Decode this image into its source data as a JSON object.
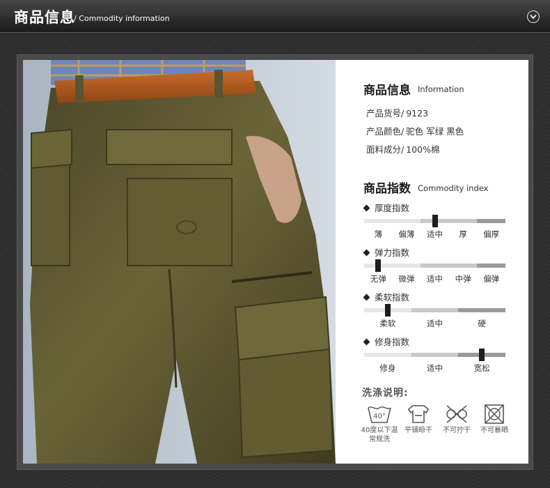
{
  "header": {
    "title": "商品信息",
    "subtitle": "/ Commodity information",
    "down_icon": "chevron-down-circle-icon"
  },
  "info": {
    "title": "商品信息",
    "title_en": "Information",
    "attributes": [
      {
        "label": "产品货号/",
        "value": "9123"
      },
      {
        "label": "产品颜色/",
        "value": "驼色 军绿 黑色"
      },
      {
        "label": "面料成分/",
        "value": "100%棉"
      }
    ]
  },
  "index": {
    "title": "商品指数",
    "title_en": "Commodity index",
    "items": [
      {
        "name": "厚度指数",
        "levels": [
          "薄",
          "偏薄",
          "适中",
          "厚",
          "偏厚"
        ],
        "selected": 2
      },
      {
        "name": "弹力指数",
        "levels": [
          "无弹",
          "微弹",
          "适中",
          "中弹",
          "偏弹"
        ],
        "selected": 0
      },
      {
        "name": "柔软指数",
        "levels": [
          "柔软",
          "适中",
          "硬"
        ],
        "selected": 0
      },
      {
        "name": "修身指数",
        "levels": [
          "修身",
          "适中",
          "宽松"
        ],
        "selected": 2
      }
    ]
  },
  "care": {
    "title": "洗涤说明:",
    "wash_temp": "40°",
    "items": [
      {
        "icon": "wash-40-icon",
        "label_line1": "40度以下温",
        "label_line2": "常规洗"
      },
      {
        "icon": "dry-flat-icon",
        "label_line1": "平铺晾干",
        "label_line2": ""
      },
      {
        "icon": "do-not-wring-icon",
        "label_line1": "不可拧干",
        "label_line2": ""
      },
      {
        "icon": "do-not-sun-dry-icon",
        "label_line1": "不可暴晒",
        "label_line2": ""
      }
    ]
  },
  "colors": {
    "pants": "#5a5530",
    "belt": "#b25a1f",
    "shirt": "#5870a8",
    "background": "#2f2f2f",
    "bar_light": "#e6e6e6",
    "bar_mid": "#c8c8c8",
    "bar_dark": "#9a9a9a",
    "marker": "#1e1e1e"
  }
}
